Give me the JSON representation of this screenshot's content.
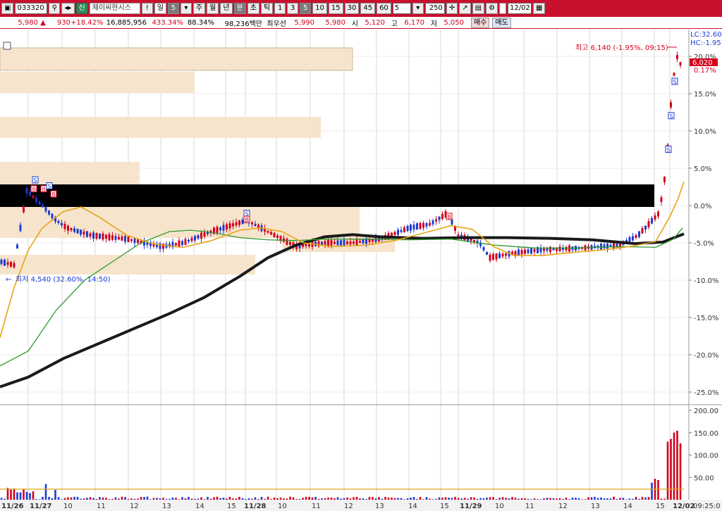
{
  "toolbar": {
    "code": "033320",
    "stock_name": "제이씨현시스",
    "period_label": "일",
    "period_value": "5",
    "periods": [
      "주",
      "월",
      "년",
      "분",
      "초",
      "틱"
    ],
    "minutes": [
      "1",
      "3",
      "5",
      "10",
      "15",
      "30",
      "45",
      "60"
    ],
    "selected_minute": "5",
    "interval_value": "5",
    "count_value": "250",
    "date_value": "12/02",
    "badge": "신",
    "mark_label": "!"
  },
  "quote": {
    "price": "5,980",
    "change": "930",
    "change_pct": "+18.42%",
    "volume": "16,885,956",
    "volume_ratio": "433.34%",
    "strength": "88.34%",
    "amount": "98,236백만",
    "best_label": "최우선",
    "ask": "5,990",
    "bid": "5,980",
    "open_label": "시",
    "open": "5,120",
    "high_label": "고",
    "high": "6,170",
    "low_label": "저",
    "low": "5,050",
    "buy_label": "매수",
    "sell_label": "매도"
  },
  "price_panel": {
    "lc_label": "LC:32.60",
    "hc_label": "HC:-1.95",
    "cur_price_tag": "6,020",
    "cur_pct_tag": "0.17%",
    "high_annotation": "최고 6,140 (-1.95%, 09:15)",
    "low_annotation": "최저 4,540 (32.60%, 14:50)",
    "y_ticks": [
      "20.0%",
      "15.0%",
      "10.0%",
      "5.0%",
      "0.0%",
      "-5.0%",
      "-10.0%",
      "-15.0%",
      "-20.0%",
      "-25.0%"
    ]
  },
  "volume_panel": {
    "y_ticks": [
      "200.00",
      "150.00",
      "100.00",
      "50.00"
    ]
  },
  "x_axis": {
    "labels": [
      "11/26",
      "11/27",
      "10",
      "11",
      "12",
      "13",
      "14",
      "15",
      "11/28",
      "10",
      "11",
      "12",
      "13",
      "14",
      "15",
      "11/29",
      "10",
      "11",
      "12",
      "13",
      "14",
      "15",
      "12/02"
    ],
    "time": "09:25:0"
  },
  "colors": {
    "up": "#d4001c",
    "down": "#1c3cd4",
    "ma_short": "#e8a317",
    "ma_mid": "#2e9b2e",
    "ma_long": "#1a1a1a",
    "band": "#f6e4cc"
  }
}
